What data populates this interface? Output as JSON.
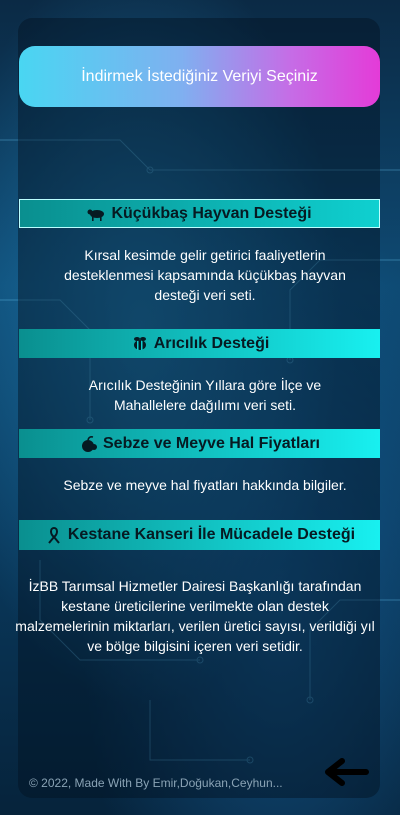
{
  "header": {
    "title": "İndirmek İstediğiniz Veriyi Seçiniz"
  },
  "sections": [
    {
      "icon": "sheep-icon",
      "title": "Küçükbaş Hayvan Desteği",
      "description": "Kırsal kesimde gelir getirici faaliyetlerin desteklenmesi kapsamında küçükbaş hayvan desteği veri seti."
    },
    {
      "icon": "bee-icon",
      "title": "Arıcılık Desteği",
      "description": "Arıcılık Desteğinin Yıllara göre İlçe ve Mahallelere dağılımı veri seti."
    },
    {
      "icon": "fruit-icon",
      "title": "Sebze ve Meyve Hal Fiyatları",
      "description": "Sebze ve meyve hal fiyatları hakkında bilgiler."
    },
    {
      "icon": "awareness-ribbon-icon",
      "title": "Kestane Kanseri İle Mücadele Desteği",
      "description": "İzBB Tarımsal Hizmetler Dairesi Başkanlığı tarafından kestane üreticilerine verilmekte olan destek malzemelerinin miktarları, verilen üretici sayısı, verildiği yıl ve bölge bilgisini içeren veri setidir."
    }
  ],
  "footer": {
    "text": "© 2022, Made With By Emir,Doğukan,Ceyhun..."
  },
  "back": {
    "icon": "back-arrow-icon"
  }
}
